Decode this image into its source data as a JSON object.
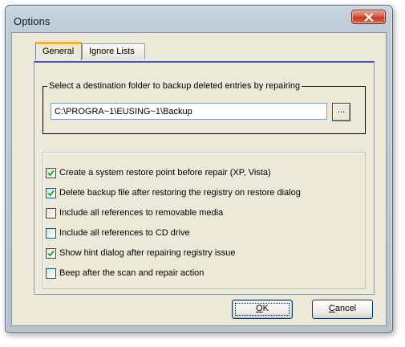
{
  "window": {
    "title": "Options",
    "close_icon": "close-icon"
  },
  "tabs": [
    {
      "label": "General",
      "active": true
    },
    {
      "label": "Ignore Lists",
      "active": false
    }
  ],
  "backup_group": {
    "legend": "Select a destination folder to backup deleted entries by repairing",
    "path_value": "C:\\PROGRA~1\\EUSING~1\\Backup",
    "browse_label": "..."
  },
  "options": [
    {
      "label": "Create a system restore point before repair (XP, Vista)",
      "checked": true
    },
    {
      "label": "Delete backup file after restoring the registry on restore dialog",
      "checked": true
    },
    {
      "label": "Include all references to removable media",
      "checked": false
    },
    {
      "label": "Include all references to CD drive",
      "checked": false
    },
    {
      "label": "Show hint dialog after repairing registry issue",
      "checked": true
    },
    {
      "label": "Beep after the scan and repair action",
      "checked": false
    }
  ],
  "buttons": {
    "ok": {
      "mnemonic": "O",
      "rest": "K"
    },
    "cancel": {
      "mnemonic": "C",
      "rest": "ancel"
    }
  },
  "colors": {
    "checkmark": "#21a121",
    "tab_highlight": "#f2b33d",
    "panel_top_border": "#3f55b0",
    "close_button": "#c23b24"
  }
}
